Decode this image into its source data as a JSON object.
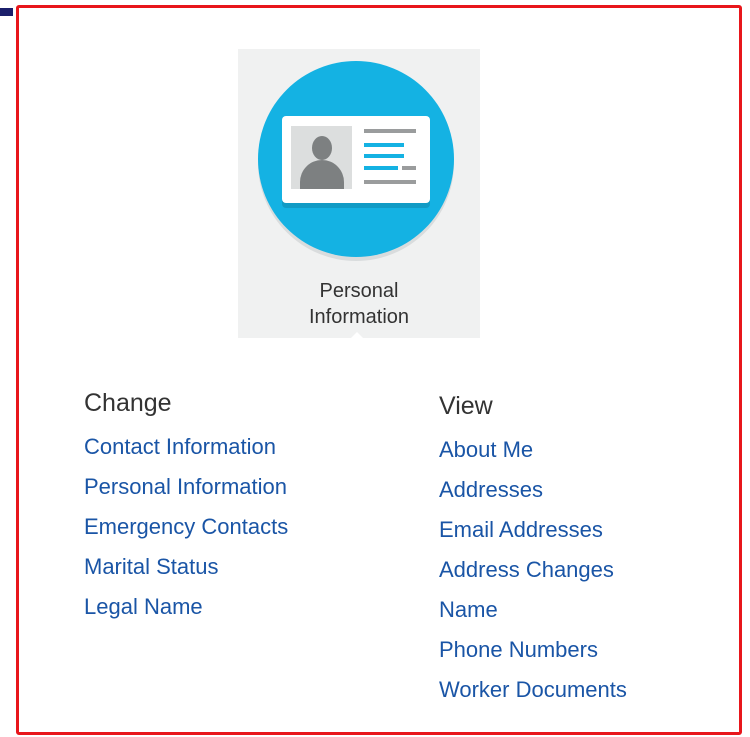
{
  "tile": {
    "label_line1": "Personal",
    "label_line2": "Information",
    "icon": "id-card-icon",
    "circle_color": "#14b2e3"
  },
  "change": {
    "title": "Change",
    "links": [
      "Contact Information",
      "Personal Information",
      "Emergency Contacts",
      "Marital Status",
      "Legal Name"
    ]
  },
  "view": {
    "title": "View",
    "links": [
      "About Me",
      "Addresses",
      "Email Addresses",
      "Address Changes",
      "Name",
      "Phone Numbers",
      "Worker Documents"
    ]
  },
  "colors": {
    "frame_border": "#e8161b",
    "link": "#1a55a6",
    "heading": "#333333"
  }
}
